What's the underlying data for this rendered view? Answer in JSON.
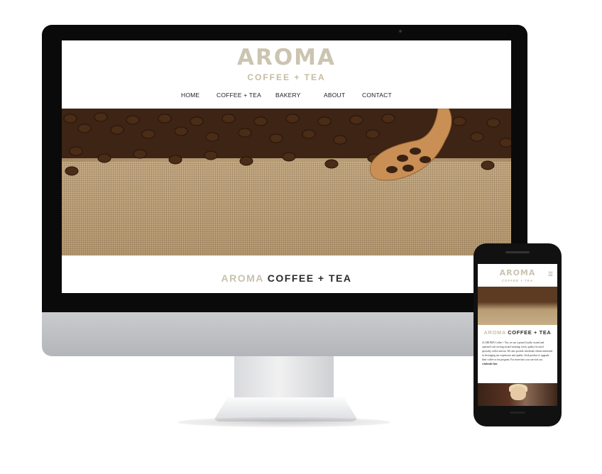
{
  "site": {
    "logo": "AROMA",
    "logo_sub": "COFFEE + TEA",
    "nav": [
      "HOME",
      "COFFEE + TEA",
      "BAKERY",
      "ABOUT",
      "CONTACT"
    ],
    "tagline_accent": "AROMA",
    "tagline_main": "COFFEE + TEA",
    "hero_image": "coffee-beans-on-burlap-with-wooden-spoon"
  },
  "mobile": {
    "logo": "AROMA",
    "logo_sub": "COFFEE + TEA",
    "menu_icon": "hamburger-icon",
    "tagline_accent": "AROMA",
    "tagline_main": "COFFEE + TEA",
    "body_text": "At AROMA Coffee + Tea, we are a proud locally owned and operated cafe serving award-winning, fresh, quality-focused specialty coffee and tea. We also provide wholesale clients interested in leveraging our experience and quality. Seek product to upgrade their coffee or tea program. For more info you can visit our",
    "body_link": "wholesale line."
  },
  "colors": {
    "logo": "#cbc4b0",
    "accent": "#c9c1ad",
    "dark_text": "#2b2b2b",
    "bezel": "#0a0a0a",
    "chin": "#c0c2c6"
  }
}
